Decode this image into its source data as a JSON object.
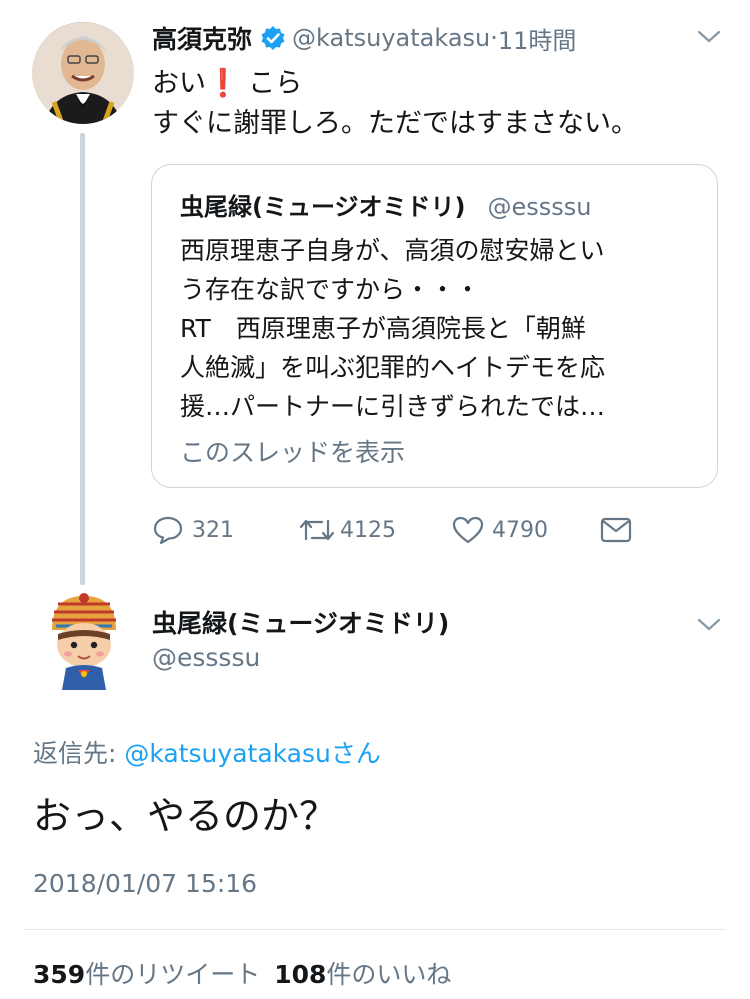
{
  "tweet1": {
    "name": "高須克弥",
    "handle": "@katsuyatakasu",
    "time": "11時間",
    "text_line1_before": "おい",
    "text_line1_emoji": "❗",
    "text_line1_after": " こら",
    "text_line2": "すぐに謝罪しろ。ただではすまさない。",
    "verified_icon": "verified-badge-icon",
    "colors": {
      "verified": "#1da1f2",
      "emoji": "#e0162b"
    }
  },
  "quote": {
    "name": "虫尾緑(ミュージオミドリ)",
    "handle": "@essssu",
    "lines": [
      "西原理恵子自身が、高須の慰安婦とい",
      "う存在な訳ですから・・・",
      "RT　西原理恵子が高須院長と「朝鮮",
      "人絶滅」を叫ぶ犯罪的ヘイトデモを応",
      "援…パートナーに引きずられたでは…"
    ],
    "show_thread": "このスレッドを表示"
  },
  "actions": {
    "replies": "321",
    "retweets": "4125",
    "likes": "4790"
  },
  "tweet2": {
    "name": "虫尾緑(ミュージオミドリ)",
    "handle": "@essssu",
    "reply_prefix": "返信先: ",
    "reply_mention": "@katsuyatakasu",
    "reply_suffix": "さん",
    "text": "おっ、やるのか？",
    "timestamp": "2018/01/07 15:16",
    "retweet_count": "359",
    "retweet_label": "件のリツイート",
    "like_count": "108",
    "like_label": "件のいいね"
  },
  "colors": {
    "accent": "#1da1f2",
    "secondary_text": "#657786",
    "border": "#ccd6dd"
  }
}
